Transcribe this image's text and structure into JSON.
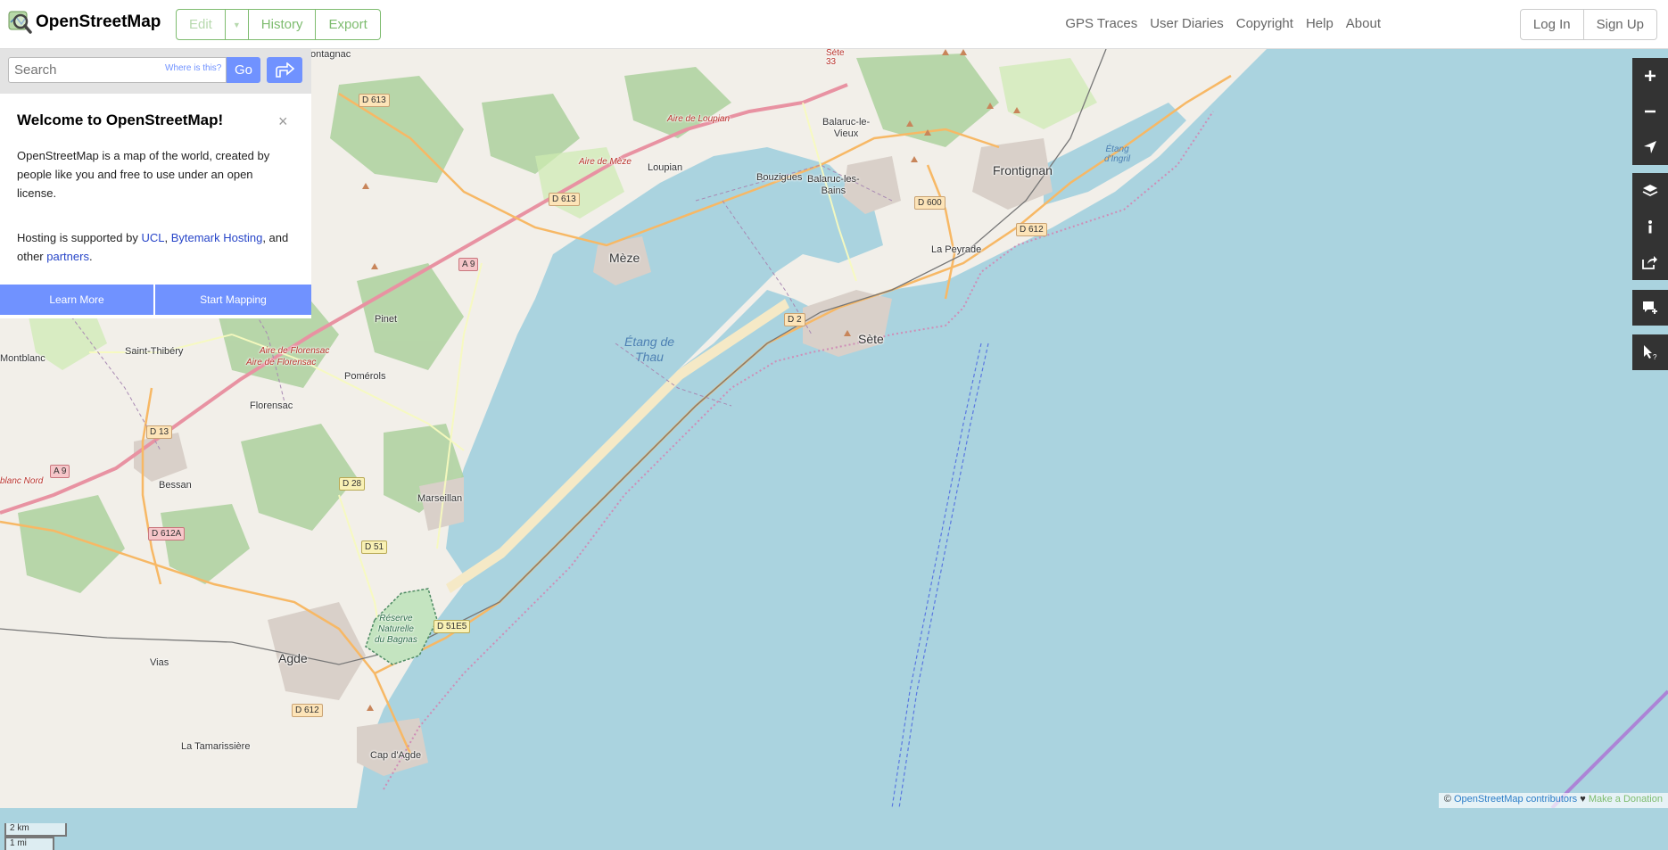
{
  "header": {
    "brand": "OpenStreetMap",
    "edit_label": "Edit",
    "history_label": "History",
    "export_label": "Export",
    "nav": [
      "GPS Traces",
      "User Diaries",
      "Copyright",
      "Help",
      "About"
    ],
    "login_label": "Log In",
    "signup_label": "Sign Up"
  },
  "search": {
    "placeholder": "Search",
    "where_label": "Where is this?",
    "go_label": "Go"
  },
  "welcome": {
    "title": "Welcome to OpenStreetMap!",
    "close_glyph": "×",
    "intro": "OpenStreetMap is a map of the world, created by people like you and free to use under an open license.",
    "hosting_prefix": "Hosting is supported by ",
    "ucl": "UCL",
    "comma": ", ",
    "bytemark": "Bytemark Hosting",
    "and_other": ", and other ",
    "partners": "partners",
    "period": ".",
    "learn_more": "Learn More",
    "start_mapping": "Start Mapping"
  },
  "map": {
    "places": {
      "sete": "Sète",
      "frontignan": "Frontignan",
      "meze": "Mèze",
      "agde": "Agde",
      "marseillan": "Marseillan",
      "la_peyrade": "La Peyrade",
      "loupian": "Loupian",
      "bouzigues": "Bouzigues",
      "balaruc_vieux": "Balaruc-le-\nVieux",
      "balaruc_bains": "Balaruc-les-\nBains",
      "pinet": "Pinet",
      "pomerols": "Pomérols",
      "florensac": "Florensac",
      "saint_thibery": "Saint-Thibéry",
      "montblanc": "Montblanc",
      "bessan": "Bessan",
      "vias": "Vias",
      "la_tamarissiere": "La Tamarissière",
      "cap_dagde": "Cap d'Agde",
      "montagnac": "ontagnac"
    },
    "water": {
      "thau": "Étang de\nThau",
      "ingril": "Étang\nd'Ingril"
    },
    "reserve": "Réserve\nNaturelle\ndu Bagnas",
    "rest_areas": {
      "loupian": "Aire de Loupian",
      "meze": "Aire de Mèze",
      "florensac1": "Aire de Florensac",
      "florensac2": "Aire de Florensac",
      "nord": "blanc Nord"
    },
    "roads": {
      "d613a": "D 613",
      "d613b": "D 613",
      "a9a": "A 9",
      "a9b": "A 9",
      "d13": "D 13",
      "d612a": "D 612A",
      "d28": "D 28",
      "d51": "D 51",
      "d51e5": "D 51E5",
      "d612b": "D 612",
      "d612c": "D 612",
      "d600": "D 600",
      "d2": "D 2",
      "sete33": "Sète\n33"
    }
  },
  "scale": {
    "metric": "2 km",
    "imperial": "1 mi"
  },
  "attribution": {
    "copy": "© ",
    "contributors": "OpenStreetMap contributors",
    "heart": " ♥ ",
    "donate": "Make a Donation"
  },
  "colors": {
    "sea": "#aad3df",
    "land": "#f2efe9",
    "forest": "#add19e",
    "accent": "#7092ff",
    "brand_green": "#7ebc6f"
  }
}
